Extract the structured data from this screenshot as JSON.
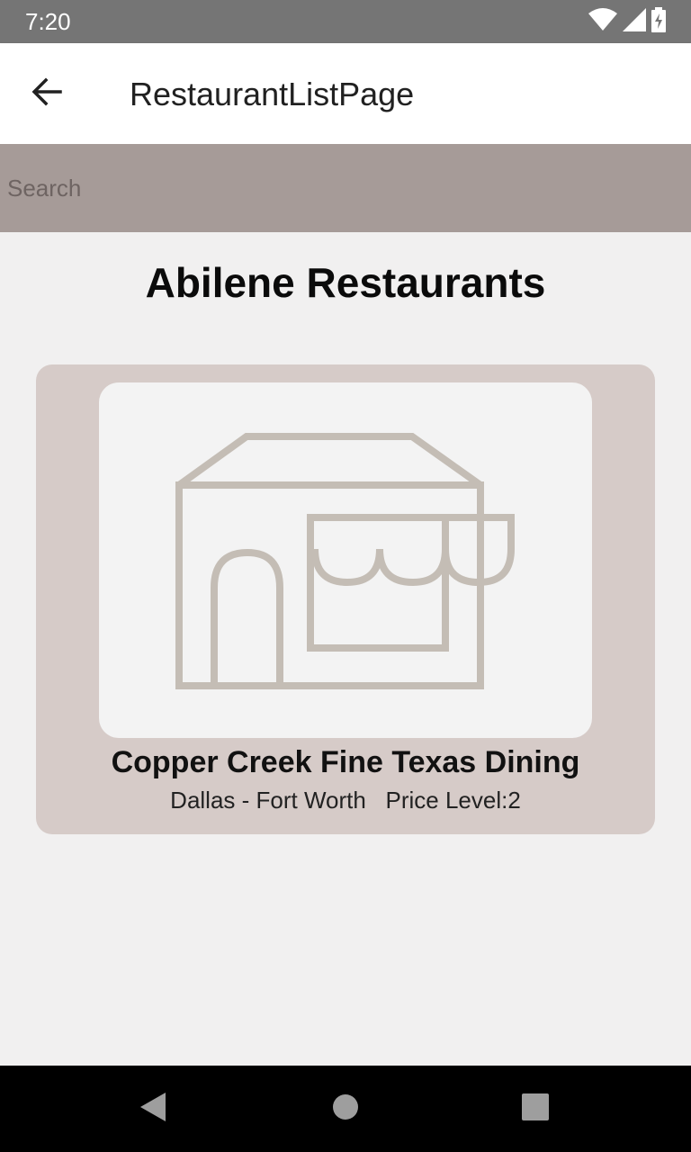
{
  "status_bar": {
    "time": "7:20",
    "icons": [
      "wifi-icon",
      "signal-icon",
      "battery-charging-icon"
    ]
  },
  "app_bar": {
    "back_icon": "arrow-back-icon",
    "title": "RestaurantListPage"
  },
  "search": {
    "placeholder": "Search",
    "value": ""
  },
  "section": {
    "title": "Abilene Restaurants"
  },
  "restaurants": [
    {
      "image_icon": "storefront-icon",
      "name": "Copper Creek Fine Texas Dining",
      "meta": "Dallas - Fort Worth   Price Level:2"
    }
  ],
  "nav_bar": {
    "icons": [
      "back-triangle-icon",
      "home-circle-icon",
      "recents-square-icon"
    ]
  },
  "colors": {
    "status_bar": "#757575",
    "app_bar": "#ffffff",
    "search_bar": "#a69b98",
    "background": "#f1f0f0",
    "card": "#d6cbc8",
    "card_image_bg": "#f3f3f3",
    "icon_stroke": "#c4bdb5",
    "nav_bar": "#000000"
  }
}
